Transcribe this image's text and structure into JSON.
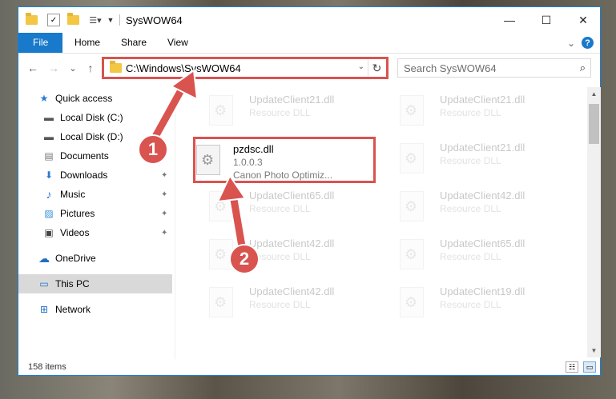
{
  "window": {
    "title": "SysWOW64",
    "minimize": "—",
    "maximize": "☐",
    "close": "✕"
  },
  "ribbon": {
    "tabs": [
      "File",
      "Home",
      "Share",
      "View"
    ],
    "collapse": "⌄",
    "help": "?"
  },
  "nav": {
    "back": "←",
    "forward": "→",
    "recent": "⌄",
    "up": "↑",
    "address_value": "C:\\Windows\\SysWOW64",
    "dropdown": "⌄",
    "refresh": "↻",
    "search_placeholder": "Search SysWOW64"
  },
  "sidebar": {
    "items": [
      {
        "label": "Quick access",
        "icon": "star-icon",
        "glyph": "★"
      },
      {
        "label": "Local Disk (C:)",
        "icon": "drive-icon",
        "glyph": "▬"
      },
      {
        "label": "Local Disk (D:)",
        "icon": "drive-icon",
        "glyph": "▬"
      },
      {
        "label": "Documents",
        "icon": "documents-icon",
        "glyph": "▤"
      },
      {
        "label": "Downloads",
        "icon": "download-icon",
        "glyph": "⬇"
      },
      {
        "label": "Music",
        "icon": "music-icon",
        "glyph": "♪"
      },
      {
        "label": "Pictures",
        "icon": "pictures-icon",
        "glyph": "▨"
      },
      {
        "label": "Videos",
        "icon": "videos-icon",
        "glyph": "▣"
      },
      {
        "label": "OneDrive",
        "icon": "cloud-icon",
        "glyph": "☁"
      },
      {
        "label": "This PC",
        "icon": "computer-icon",
        "glyph": "▭"
      },
      {
        "label": "Network",
        "icon": "network-icon",
        "glyph": "⊞"
      }
    ],
    "pin_glyph": "📌"
  },
  "files": {
    "highlighted": {
      "name": "pzdsc.dll",
      "version": "1.0.0.3",
      "description": "Canon Photo Optimiz..."
    },
    "faded": [
      {
        "name": "UpdateClient21.dll",
        "type": "Resource DLL"
      },
      {
        "name": "UpdateClient21.dll",
        "type": "Resource DLL"
      },
      {
        "name": "UpdateClient21.dll",
        "type": "Resource DLL"
      },
      {
        "name": "UpdateClient65.dll",
        "type": "Resource DLL"
      },
      {
        "name": "UpdateClient42.dll",
        "type": "Resource DLL"
      },
      {
        "name": "UpdateClient42.dll",
        "type": "Resource DLL"
      },
      {
        "name": "UpdateClient65.dll",
        "type": "Resource DLL"
      },
      {
        "name": "UpdateClient42.dll",
        "type": "Resource DLL"
      },
      {
        "name": "UpdateClient19.dll",
        "type": "Resource DLL"
      }
    ]
  },
  "status": {
    "item_count": "158 items"
  },
  "callouts": [
    "1",
    "2"
  ],
  "colors": {
    "accent": "#1979ca",
    "highlight": "#d9534f"
  }
}
